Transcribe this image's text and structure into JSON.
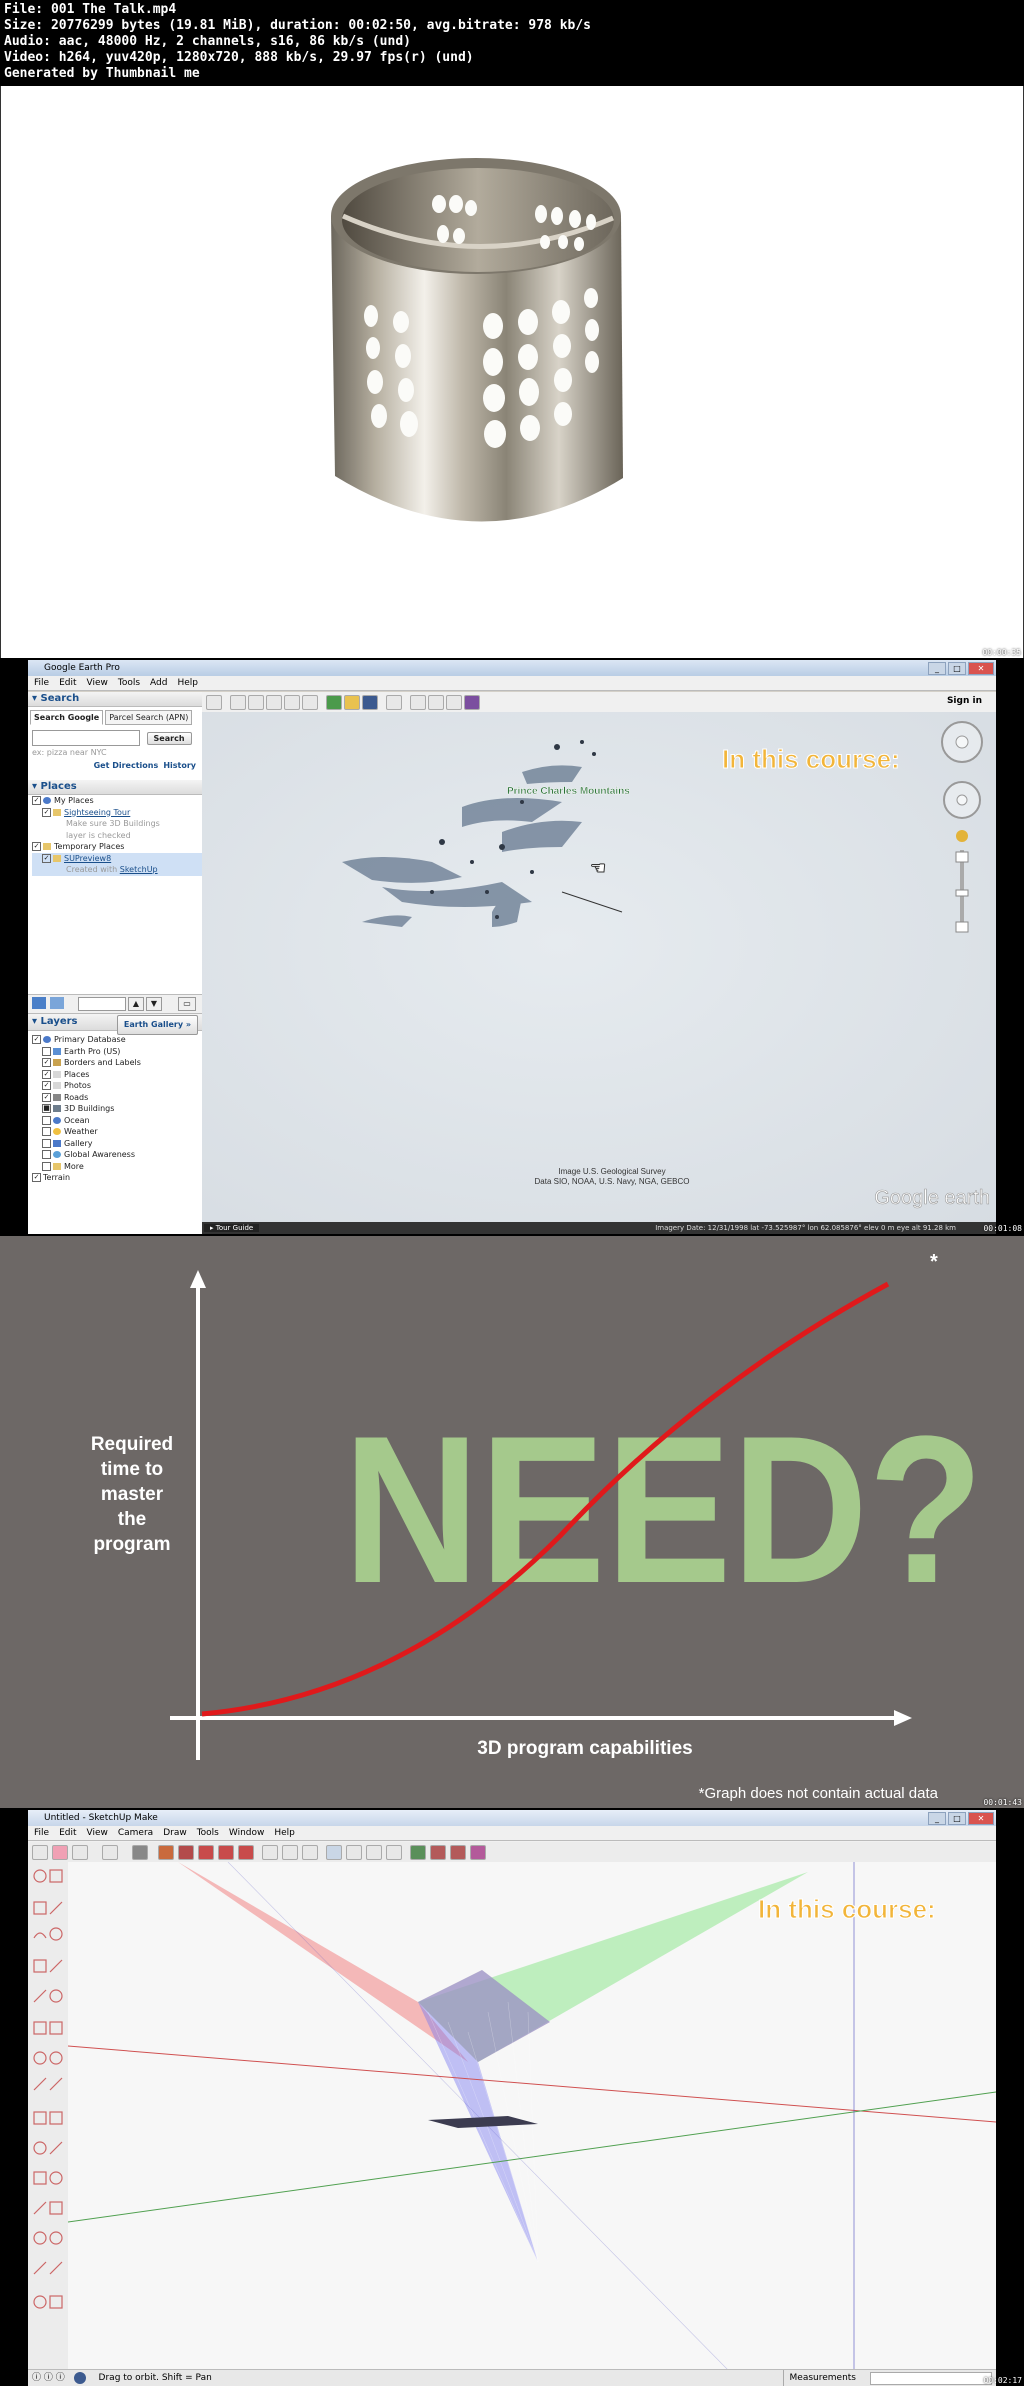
{
  "header": {
    "file": "File: 001 The Talk.mp4",
    "size": "Size: 20776299 bytes (19.81 MiB), duration: 00:02:50, avg.bitrate: 978 kb/s",
    "audio": "Audio: aac, 48000 Hz, 2 channels, s16, 86 kb/s (und)",
    "video": "Video: h264, yuv420p, 1280x720, 888 kb/s, 29.97 fps(r) (und)",
    "generated": "Generated by Thumbnail me"
  },
  "timestamps": [
    "00:00:35",
    "00:01:08",
    "00:01:43",
    "00:02:17"
  ],
  "earth": {
    "title": "Google Earth Pro",
    "menu": [
      "File",
      "Edit",
      "View",
      "Tools",
      "Add",
      "Help"
    ],
    "search_header": "Search",
    "tabs": [
      "Search Google",
      "Parcel Search (APN)"
    ],
    "search_button": "Search",
    "search_hint": "ex: pizza near NYC",
    "get_directions": "Get Directions",
    "history": "History",
    "places_header": "Places",
    "my_places": "My Places",
    "sightseeing": "Sightseeing Tour",
    "sightseeing_note1": "Make sure 3D Buildings",
    "sightseeing_note2": "layer is checked",
    "temporary": "Temporary Places",
    "supreview": "SUPreview8",
    "created_with": "Created with",
    "sketchup_link": "SketchUp",
    "layers_header": "Layers",
    "gallery_btn": "Earth Gallery »",
    "layers": [
      "Primary Database",
      "Earth Pro (US)",
      "Borders and Labels",
      "Places",
      "Photos",
      "Roads",
      "3D Buildings",
      "Ocean",
      "Weather",
      "Gallery",
      "Global Awareness",
      "More",
      "Terrain"
    ],
    "sign_in": "Sign in",
    "overlay": "In this course:",
    "map_label": "Prince Charles Mountains",
    "credit1": "Image U.S. Geological Survey",
    "credit2": "Data SIO, NOAA, U.S. Navy, NGA, GEBCO",
    "logo": "Google earth",
    "tour_guide": "Tour Guide",
    "status": "Imagery Date: 12/31/1998     lat -73.525987°  lon 62.085876° elev 0 m     eye alt 91.28 km"
  },
  "graph": {
    "main_text": "NEED?",
    "ylabel_lines": [
      "Required",
      "time to",
      "master",
      "the",
      "program"
    ],
    "xlabel": "3D program capabilities",
    "footnote": "*Graph does not contain actual data",
    "star": "*"
  },
  "sketchup": {
    "title": "Untitled - SketchUp Make",
    "menu": [
      "File",
      "Edit",
      "View",
      "Camera",
      "Draw",
      "Tools",
      "Window",
      "Help"
    ],
    "overlay": "In this course:",
    "status_hint": "Drag to orbit.  Shift = Pan",
    "measurements": "Measurements"
  },
  "colors": {
    "graph_bg": "#6d6866",
    "need_green": "#a5c98c",
    "curve_red": "#e0191b",
    "overlay_yellow": "#f2b53a"
  }
}
